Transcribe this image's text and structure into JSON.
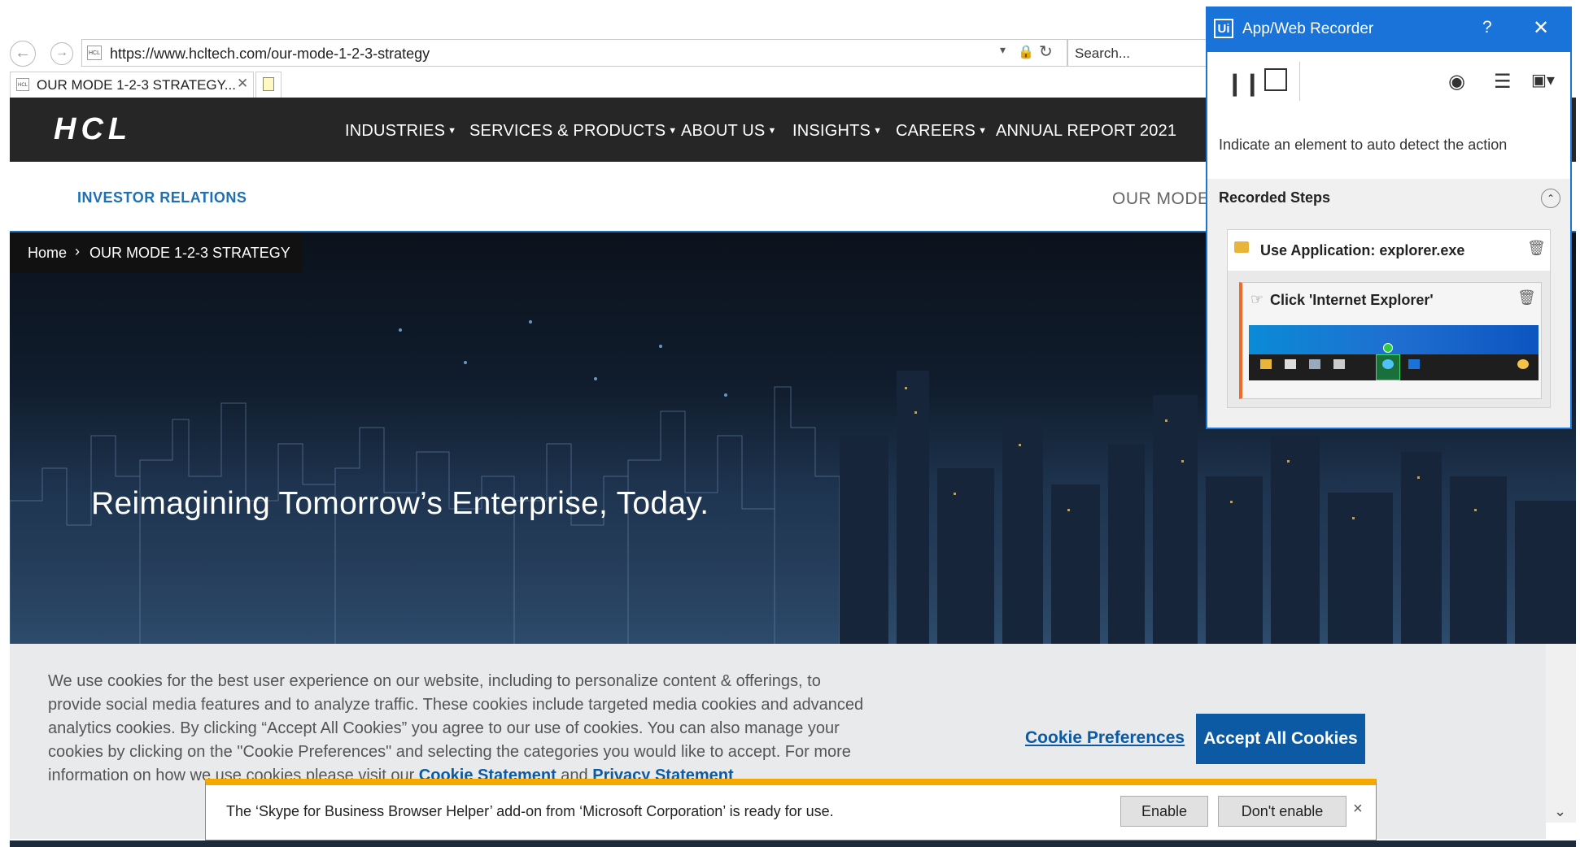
{
  "browser": {
    "url": "https://www.hcltech.com/our-mode-1-2-3-strategy",
    "search_placeholder": "Search...",
    "tab_title": "OUR MODE 1-2-3 STRATEGY...",
    "favicon_text": "HCL",
    "back_icon": "arrow-left",
    "forward_icon": "arrow-right"
  },
  "site": {
    "logo": "HCL",
    "nav": [
      {
        "label": "INDUSTRIES",
        "dropdown": true
      },
      {
        "label": "SERVICES & PRODUCTS",
        "dropdown": true
      },
      {
        "label": "ABOUT US",
        "dropdown": true
      },
      {
        "label": "INSIGHTS",
        "dropdown": true
      },
      {
        "label": "CAREERS",
        "dropdown": true
      },
      {
        "label": "ANNUAL REPORT 2021",
        "dropdown": false
      }
    ],
    "investor_relations": "INVESTOR RELATIONS",
    "subnav_right": "OUR MODE",
    "breadcrumb": {
      "home": "Home",
      "separator": "›",
      "current": "OUR MODE 1-2-3 STRATEGY"
    },
    "hero_title": "Reimagining Tomorrow’s Enterprise, Today."
  },
  "cookie": {
    "text_before": "We use cookies for the best user experience on our website, including to personalize content & offerings, to provide social media features and to analyze traffic. These cookies include targeted media cookies and advanced analytics cookies. By clicking “Accept All Cookies” you agree to our use of cookies. You can also manage your cookies by clicking on the \"Cookie Preferences\" and selecting the categories you would like to accept. For more information on how we use cookies please visit our",
    "statement_link": "Cookie Statement",
    "and": "and",
    "privacy_link": "Privacy Statement",
    "preferences_label": "Cookie Preferences",
    "accept_label": "Accept All Cookies"
  },
  "notification": {
    "text": "The ‘Skype for Business Browser Helper’ add-on from ‘Microsoft Corporation’ is ready for use.",
    "enable_label": "Enable",
    "dont_enable_label": "Don't enable",
    "close_label": "×"
  },
  "recorder": {
    "title": "App/Web Recorder",
    "logo": "Ui",
    "help": "?",
    "close": "✕",
    "instruction": "Indicate an element to auto detect the action",
    "steps_title": "Recorded Steps",
    "step1_label": "Use Application: explorer.exe",
    "step2_label": "Click 'Internet Explorer'",
    "accent_color": "#1a73d8"
  },
  "colors": {
    "nav_bg": "#262626",
    "link_blue": "#0b5aa3",
    "notify_accent": "#f5a800"
  }
}
